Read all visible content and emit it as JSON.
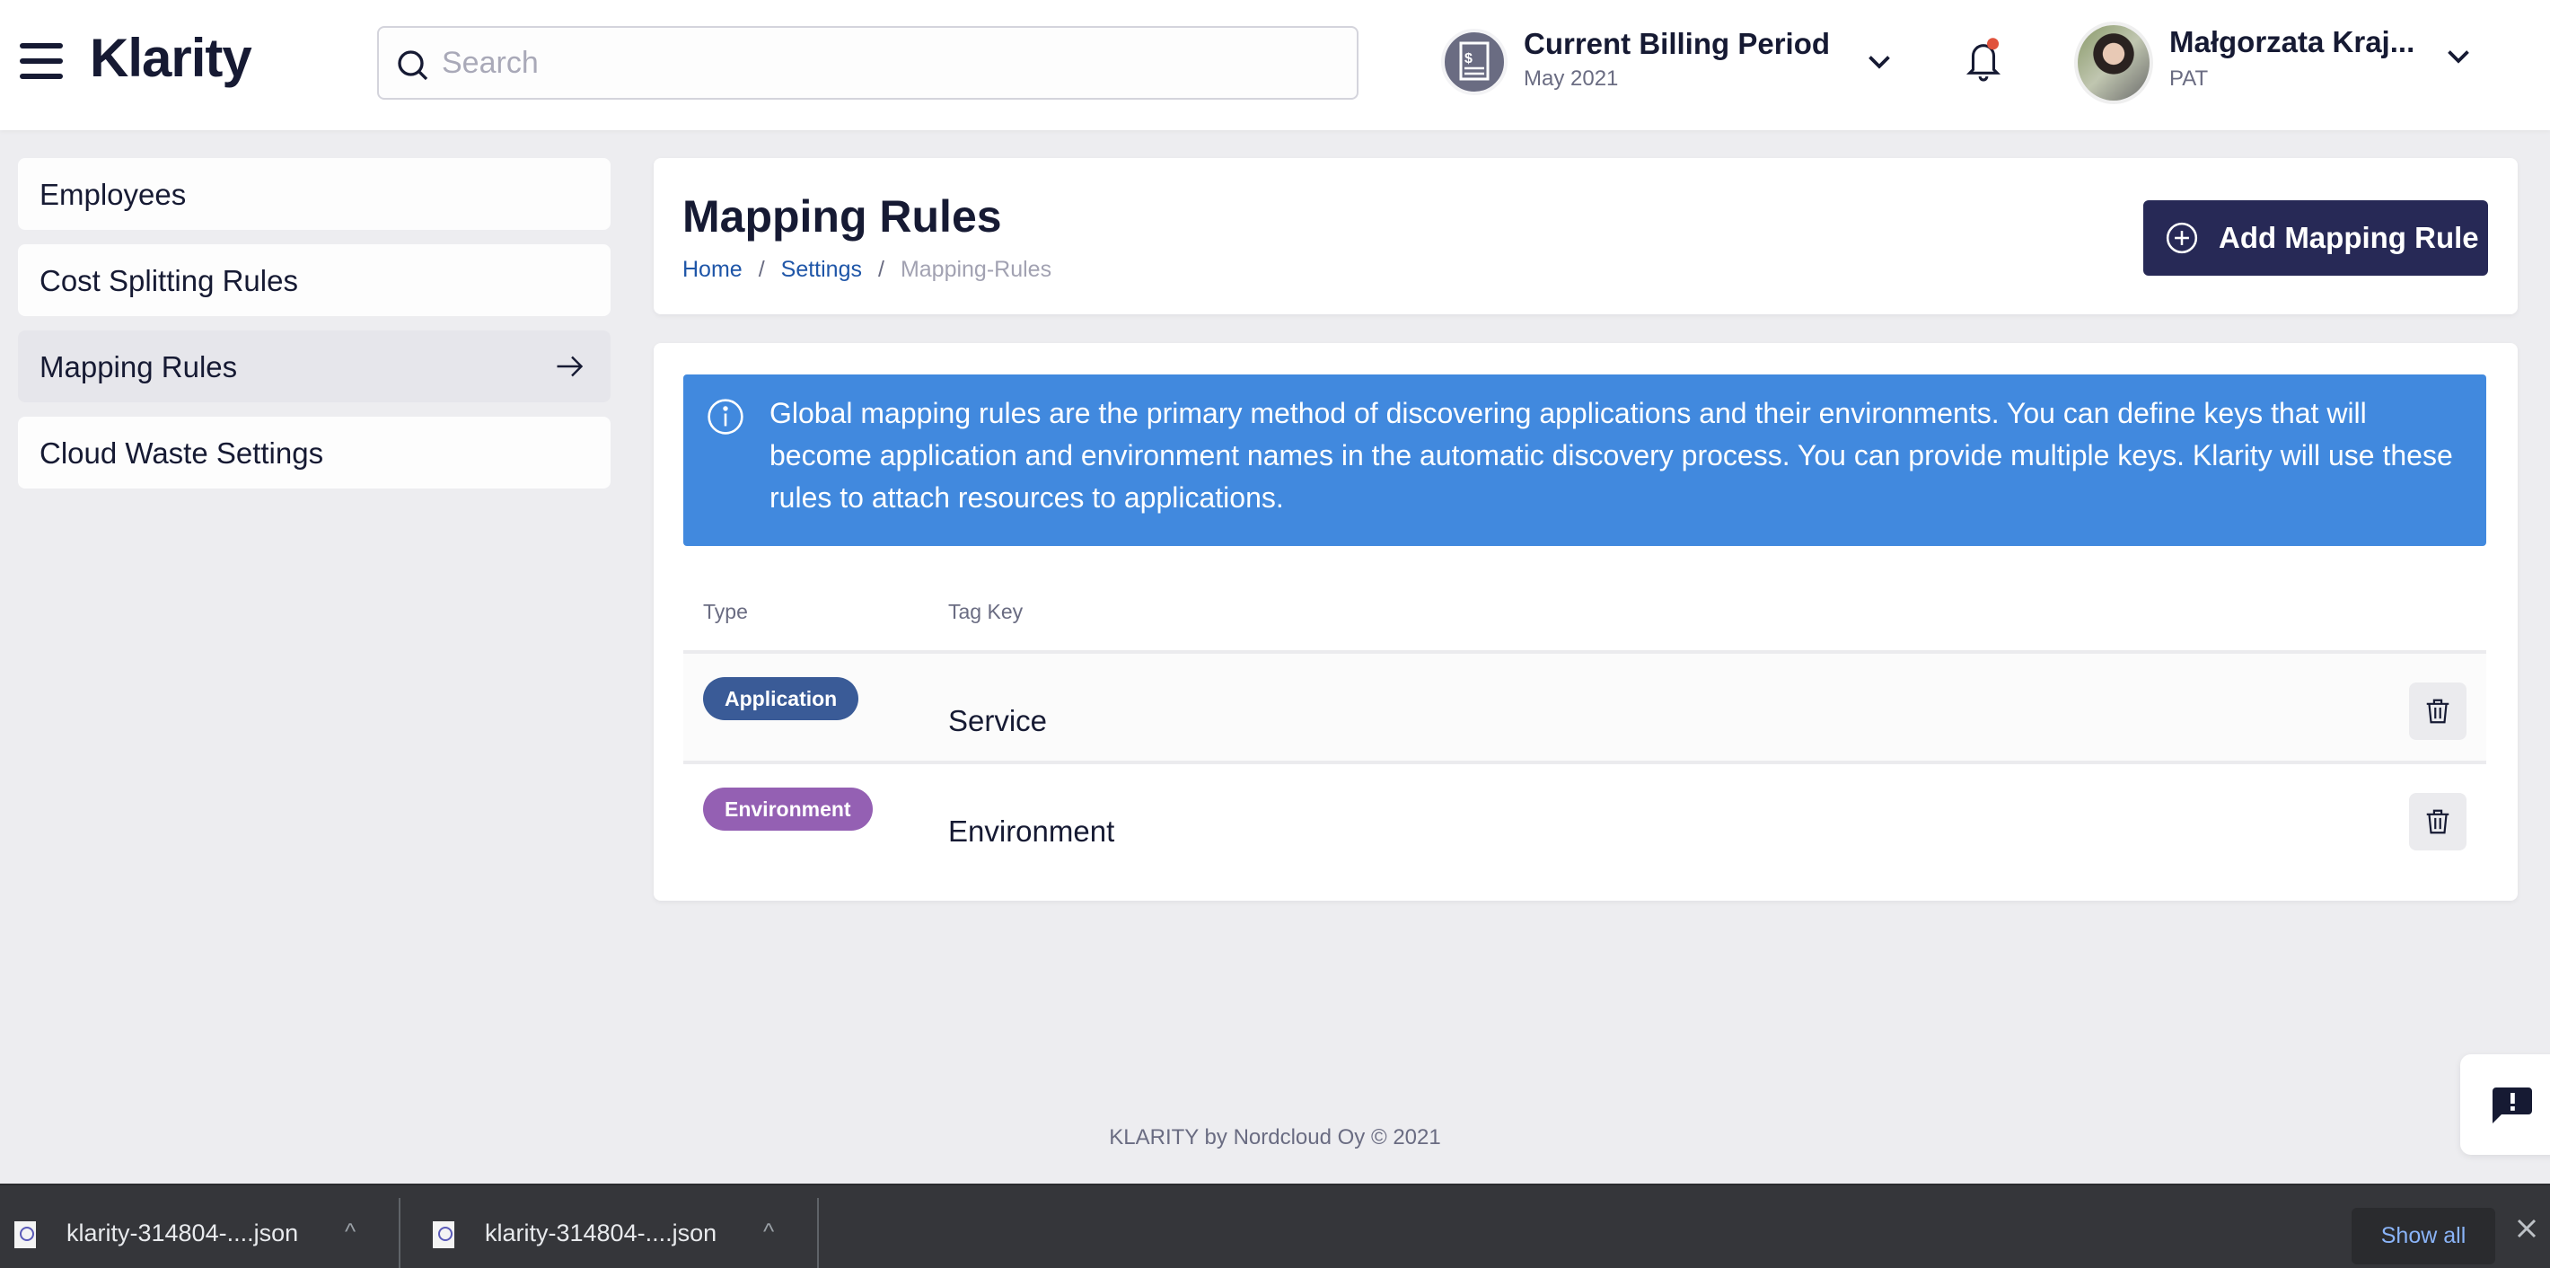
{
  "header": {
    "app_name": "Klarity",
    "search_placeholder": "Search",
    "search_value": "",
    "billing": {
      "title": "Current Billing Period",
      "period": "May 2021"
    },
    "notifications": {
      "has_unread": true,
      "dot_color": "#e0533d"
    },
    "user": {
      "name": "Małgorzata Kraj...",
      "role": "PAT"
    }
  },
  "sidebar": {
    "items": [
      {
        "label": "Employees",
        "active": false
      },
      {
        "label": "Cost Splitting Rules",
        "active": false
      },
      {
        "label": "Mapping Rules",
        "active": true
      },
      {
        "label": "Cloud Waste Settings",
        "active": false
      }
    ]
  },
  "page": {
    "title": "Mapping Rules",
    "breadcrumb": [
      "Home",
      "Settings",
      "Mapping-Rules"
    ],
    "add_button_label": "Add Mapping Rule",
    "info_text": "Global mapping rules are the primary method of discovering applications and their environments. You can define keys that will become application and environment names in the automatic discovery process. You can provide multiple keys. Klarity will use these rules to attach resources to applications.",
    "table": {
      "columns": [
        "Type",
        "Tag Key"
      ],
      "rows": [
        {
          "type": "Application",
          "type_color": "#3a5b97",
          "tag_key": "Service"
        },
        {
          "type": "Environment",
          "type_color": "#9460b3",
          "tag_key": "Environment"
        }
      ]
    }
  },
  "footer": {
    "text": "KLARITY by Nordcloud Oy © 2021"
  },
  "downloads": {
    "items": [
      {
        "filename": "klarity-314804-....json"
      },
      {
        "filename": "klarity-314804-....json"
      }
    ],
    "show_all_label": "Show all"
  },
  "colors": {
    "primary": "#272956",
    "info": "#4189de",
    "link": "#1f56a8",
    "background": "#ededf0"
  }
}
